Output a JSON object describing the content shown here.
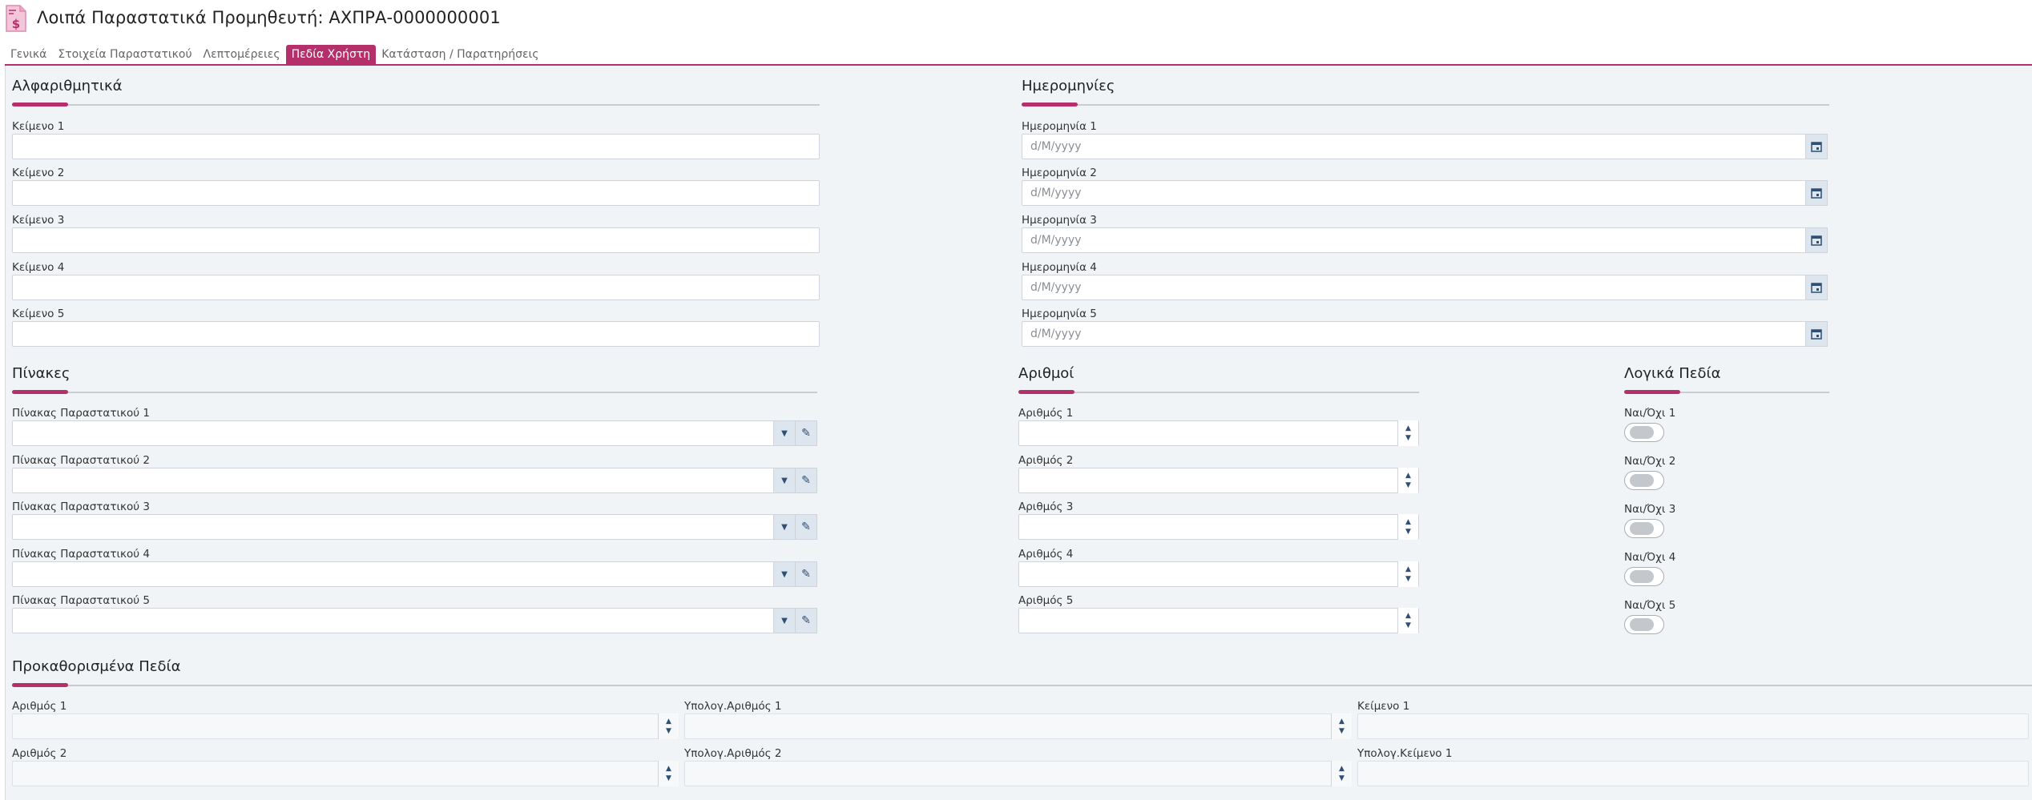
{
  "header": {
    "title": "Λοιπά Παραστατικά Προμηθευτή: ΑΧΠΡΑ-0000000001",
    "icon": "invoice-dollar-icon"
  },
  "tabs": [
    {
      "label": "Γενικά",
      "active": false
    },
    {
      "label": "Στοιχεία Παραστατικού",
      "active": false
    },
    {
      "label": "Λεπτομέρειες",
      "active": false
    },
    {
      "label": "Πεδία Χρήστη",
      "active": true
    },
    {
      "label": "Κατάσταση / Παρατηρήσεις",
      "active": false
    }
  ],
  "alpha": {
    "title": "Αλφαριθμητικά",
    "fields": [
      "Κείμενο 1",
      "Κείμενο 2",
      "Κείμενο 3",
      "Κείμενο 4",
      "Κείμενο 5"
    ]
  },
  "dates": {
    "title": "Ημερομηνίες",
    "placeholder": "d/M/yyyy",
    "fields": [
      "Ημερομηνία 1",
      "Ημερομηνία 2",
      "Ημερομηνία 3",
      "Ημερομηνία 4",
      "Ημερομηνία 5"
    ]
  },
  "tables": {
    "title": "Πίνακες",
    "fields": [
      "Πίνακας Παραστατικού 1",
      "Πίνακας Παραστατικού 2",
      "Πίνακας Παραστατικού 3",
      "Πίνακας Παραστατικού 4",
      "Πίνακας Παραστατικού 5"
    ]
  },
  "numbers": {
    "title": "Αριθμοί",
    "fields": [
      "Αριθμός 1",
      "Αριθμός 2",
      "Αριθμός 3",
      "Αριθμός 4",
      "Αριθμός 5"
    ]
  },
  "booleans": {
    "title": "Λογικά Πεδία",
    "fields": [
      "Ναι/Όχι 1",
      "Ναι/Όχι 2",
      "Ναι/Όχι 3",
      "Ναι/Όχι 4",
      "Ναι/Όχι 5"
    ]
  },
  "predefined": {
    "title": "Προκαθορισμένα Πεδία",
    "col1": [
      "Αριθμός 1",
      "Αριθμός 2"
    ],
    "col2": [
      "Υπολογ.Αριθμός 1",
      "Υπολογ.Αριθμός 2"
    ],
    "col3": [
      "Κείμενο 1",
      "Υπολογ.Κείμενο 1"
    ]
  },
  "colors": {
    "accent": "#b5306a",
    "background": "#f1f4f6"
  }
}
